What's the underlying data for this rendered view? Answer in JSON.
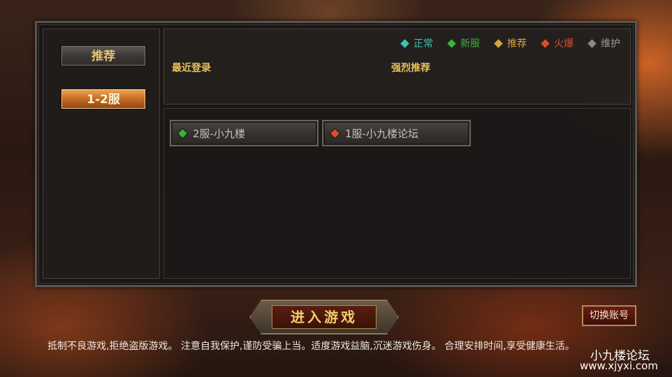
{
  "sidebar": {
    "categories": [
      {
        "label": "推荐"
      },
      {
        "label": "1-2服"
      }
    ]
  },
  "legend": [
    {
      "label": "正常",
      "color": "#3cc6b6",
      "icon": "gem-cyan-icon"
    },
    {
      "label": "新服",
      "color": "#3fb03a",
      "icon": "gem-green-icon"
    },
    {
      "label": "推荐",
      "color": "#d9a43a",
      "icon": "gem-gold-icon"
    },
    {
      "label": "火爆",
      "color": "#d4502a",
      "icon": "gem-red-icon"
    },
    {
      "label": "维护",
      "color": "#8a8a8a",
      "icon": "gem-gray-icon"
    }
  ],
  "sections": {
    "recent_login": "最近登录",
    "strong_recommend": "强烈推荐"
  },
  "servers": [
    {
      "name": "2服-小九楼",
      "status": "新服",
      "gem_color": "#3fb03a"
    },
    {
      "name": "1服-小九楼论坛",
      "status": "火爆",
      "gem_color": "#d4502a"
    }
  ],
  "actions": {
    "enter_game": "进入游戏",
    "switch_account": "切换账号"
  },
  "notice": "抵制不良游戏,拒绝盗版游戏。 注意自我保护,谨防受骗上当。适度游戏益脑,沉迷游戏伤身。 合理安排时间,享受健康生活。",
  "watermark": {
    "name": "小九楼论坛",
    "url": "www.xjyxi.com"
  }
}
